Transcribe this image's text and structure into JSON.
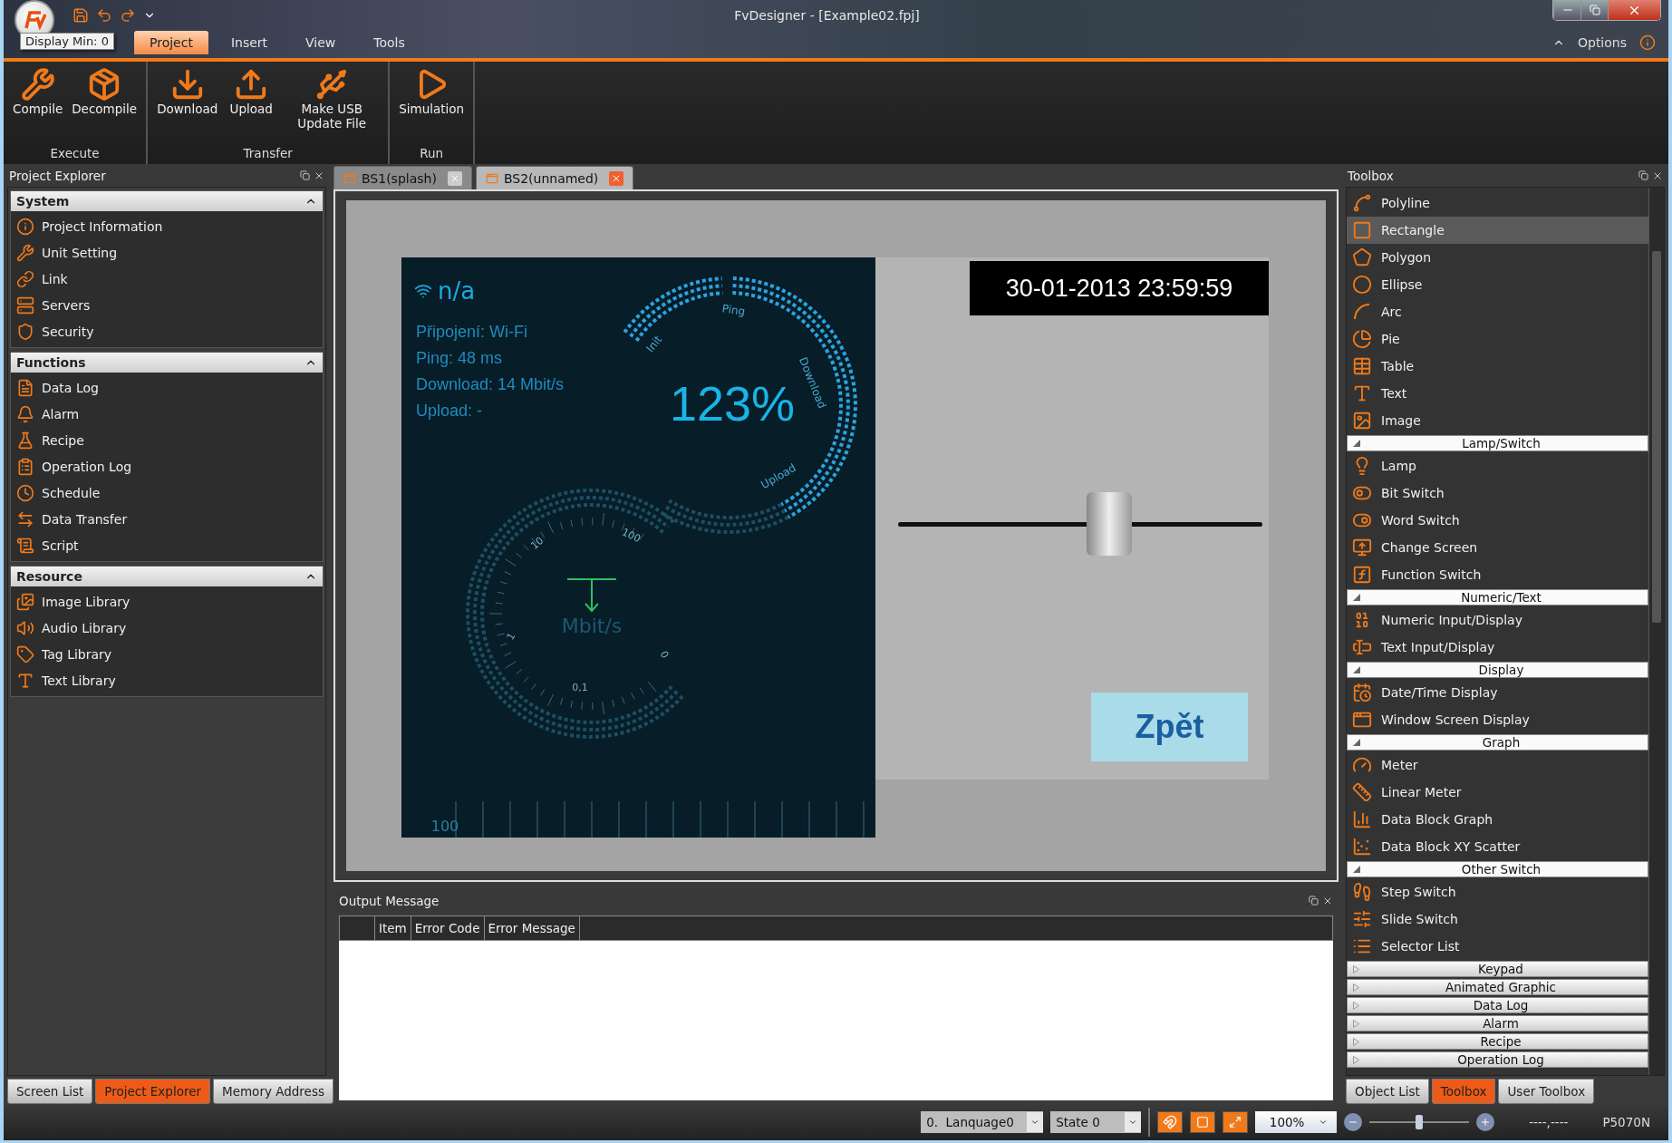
{
  "window": {
    "title": "FvDesigner - [Example02.fpj]",
    "tooltip": "Display Min: 0"
  },
  "menu_tabs": [
    {
      "label": "Project",
      "selected": true
    },
    {
      "label": "Insert",
      "selected": false
    },
    {
      "label": "View",
      "selected": false
    },
    {
      "label": "Tools",
      "selected": false
    }
  ],
  "options": "Options",
  "ribbon": [
    {
      "label": "Execute",
      "buttons": [
        {
          "label": "Compile"
        },
        {
          "label": "Decompile"
        }
      ]
    },
    {
      "label": "Transfer",
      "buttons": [
        {
          "label": "Download"
        },
        {
          "label": "Upload"
        },
        {
          "label": "Make USB Update File"
        }
      ]
    },
    {
      "label": "Run",
      "buttons": [
        {
          "label": "Simulation"
        }
      ]
    }
  ],
  "project_explorer": {
    "title": "Project Explorer",
    "sections": [
      {
        "title": "System",
        "expanded": true,
        "items": [
          {
            "label": "Project Information"
          },
          {
            "label": "Unit Setting"
          },
          {
            "label": "Link"
          },
          {
            "label": "Servers"
          },
          {
            "label": "Security"
          }
        ]
      },
      {
        "title": "Functions",
        "expanded": true,
        "items": [
          {
            "label": "Data Log"
          },
          {
            "label": "Alarm"
          },
          {
            "label": "Recipe"
          },
          {
            "label": "Operation Log"
          },
          {
            "label": "Schedule"
          },
          {
            "label": "Data Transfer"
          },
          {
            "label": "Script"
          }
        ]
      },
      {
        "title": "Resource",
        "expanded": true,
        "items": [
          {
            "label": "Image Library"
          },
          {
            "label": "Audio Library"
          },
          {
            "label": "Tag Library"
          },
          {
            "label": "Text Library"
          }
        ]
      }
    ]
  },
  "left_tabs": [
    {
      "label": "Screen List",
      "selected": false
    },
    {
      "label": "Project Explorer",
      "selected": true
    },
    {
      "label": "Memory Address",
      "selected": false
    }
  ],
  "document_tabs": [
    {
      "label": "BS1(splash)",
      "selected": false
    },
    {
      "label": "BS2(unnamed)",
      "selected": true
    }
  ],
  "screen": {
    "status": "n/a",
    "lines": [
      "Připojení: Wi-Fi",
      "Ping: 48 ms",
      "Download: 14 Mbit/s",
      "Upload: -"
    ],
    "percent": "123%",
    "ring_labels": [
      "Init",
      "Ping",
      "Download",
      "Upload"
    ],
    "scale_labels": [
      "10",
      "100",
      "1",
      "0,1",
      "0"
    ],
    "unit": "Mbit/s",
    "bottom_label": "100",
    "datetime": "30-01-2013 23:59:59",
    "slider": {
      "level": 0.58
    },
    "button": "Zpět"
  },
  "output": {
    "title": "Output Message",
    "columns": [
      "Item",
      "Error Code",
      "Error Message"
    ]
  },
  "toolbox": {
    "title": "Toolbox",
    "items": [
      {
        "kind": "tool",
        "label": "Polyline",
        "selected": false
      },
      {
        "kind": "tool",
        "label": "Rectangle",
        "selected": true
      },
      {
        "kind": "tool",
        "label": "Polygon",
        "selected": false
      },
      {
        "kind": "tool",
        "label": "Ellipse",
        "selected": false
      },
      {
        "kind": "tool",
        "label": "Arc",
        "selected": false
      },
      {
        "kind": "tool",
        "label": "Pie",
        "selected": false
      },
      {
        "kind": "tool",
        "label": "Table",
        "selected": false
      },
      {
        "kind": "tool",
        "label": "Text",
        "selected": false
      },
      {
        "kind": "tool",
        "label": "Image",
        "selected": false
      },
      {
        "kind": "category",
        "label": "Lamp/Switch",
        "expanded": true
      },
      {
        "kind": "tool",
        "label": "Lamp",
        "selected": false
      },
      {
        "kind": "tool",
        "label": "Bit Switch",
        "selected": false
      },
      {
        "kind": "tool",
        "label": "Word Switch",
        "selected": false
      },
      {
        "kind": "tool",
        "label": "Change Screen",
        "selected": false
      },
      {
        "kind": "tool",
        "label": "Function Switch",
        "selected": false
      },
      {
        "kind": "category",
        "label": "Numeric/Text",
        "expanded": true
      },
      {
        "kind": "tool",
        "label": "Numeric Input/Display",
        "selected": false
      },
      {
        "kind": "tool",
        "label": "Text Input/Display",
        "selected": false
      },
      {
        "kind": "category",
        "label": "Display",
        "expanded": true
      },
      {
        "kind": "tool",
        "label": "Date/Time Display",
        "selected": false
      },
      {
        "kind": "tool",
        "label": "Window Screen Display",
        "selected": false
      },
      {
        "kind": "category",
        "label": "Graph",
        "expanded": true
      },
      {
        "kind": "tool",
        "label": "Meter",
        "selected": false
      },
      {
        "kind": "tool",
        "label": "Linear Meter",
        "selected": false
      },
      {
        "kind": "tool",
        "label": "Data Block Graph",
        "selected": false
      },
      {
        "kind": "tool",
        "label": "Data Block XY Scatter",
        "selected": false
      },
      {
        "kind": "category",
        "label": "Other Switch",
        "expanded": true
      },
      {
        "kind": "tool",
        "label": "Step Switch",
        "selected": false
      },
      {
        "kind": "tool",
        "label": "Slide Switch",
        "selected": false
      },
      {
        "kind": "tool",
        "label": "Selector List",
        "selected": false
      },
      {
        "kind": "category",
        "label": "Keypad",
        "expanded": false
      },
      {
        "kind": "category",
        "label": "Animated Graphic",
        "expanded": false
      },
      {
        "kind": "category",
        "label": "Data Log",
        "expanded": false
      },
      {
        "kind": "category",
        "label": "Alarm",
        "expanded": false
      },
      {
        "kind": "category",
        "label": "Recipe",
        "expanded": false
      },
      {
        "kind": "category",
        "label": "Operation Log",
        "expanded": false
      }
    ]
  },
  "right_tabs": [
    {
      "label": "Object List",
      "selected": false
    },
    {
      "label": "Toolbox",
      "selected": true
    },
    {
      "label": "User Toolbox",
      "selected": false
    }
  ],
  "status_bar": {
    "language": "0.  Lanquage0",
    "state": "State 0",
    "zoom": "100%",
    "zoom_slider": {
      "level": 0.5
    },
    "coords": "----,----",
    "model": "P5070N"
  }
}
